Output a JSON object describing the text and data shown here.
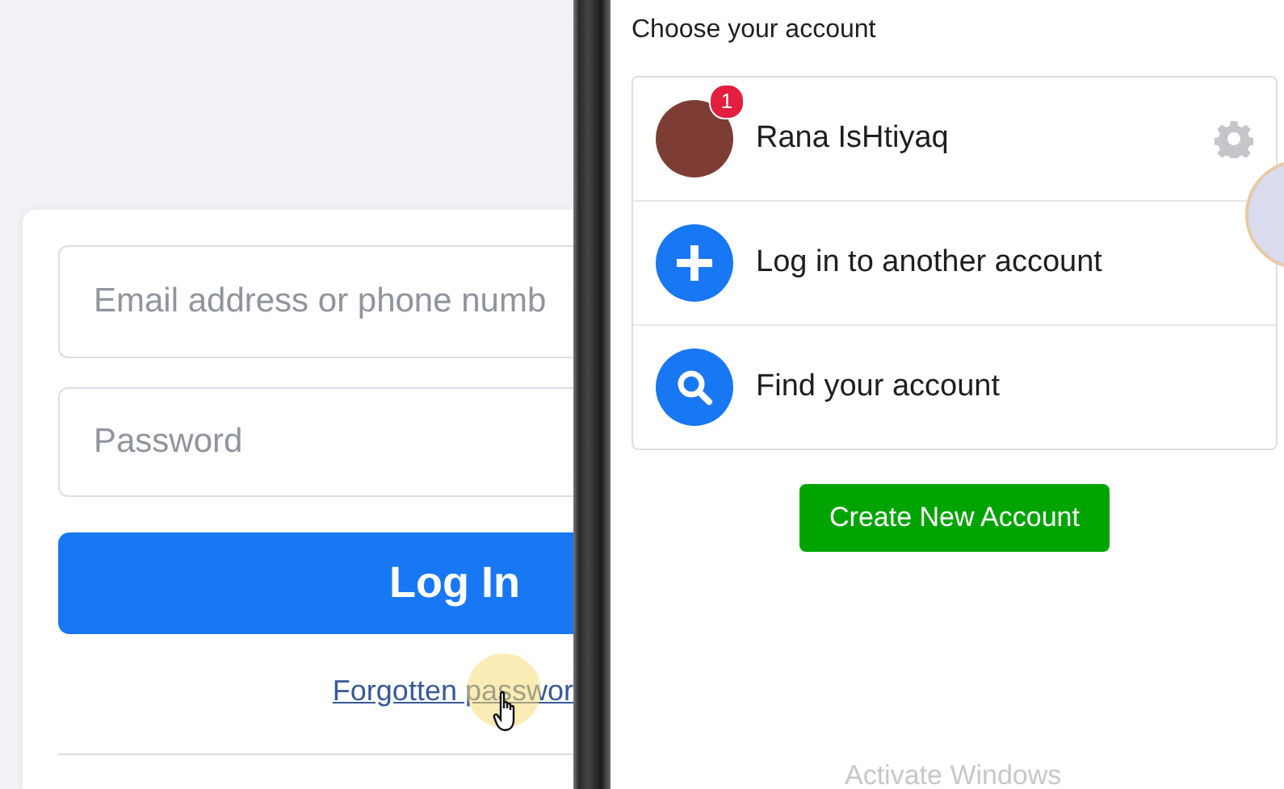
{
  "login_form": {
    "email": {
      "placeholder": "Email address or phone numb"
    },
    "password": {
      "placeholder": "Password"
    },
    "login_button": "Log In",
    "forgot_link": "Forgotten passwor"
  },
  "account_chooser": {
    "title": "Choose your account",
    "items": [
      {
        "kind": "account",
        "label": "Rana IsHtiyaq",
        "badge": "1"
      },
      {
        "kind": "add",
        "label": "Log in to another account"
      },
      {
        "kind": "find",
        "label": "Find your account"
      }
    ],
    "create_button": "Create New Account"
  },
  "watermark_text": "Activate Windows"
}
